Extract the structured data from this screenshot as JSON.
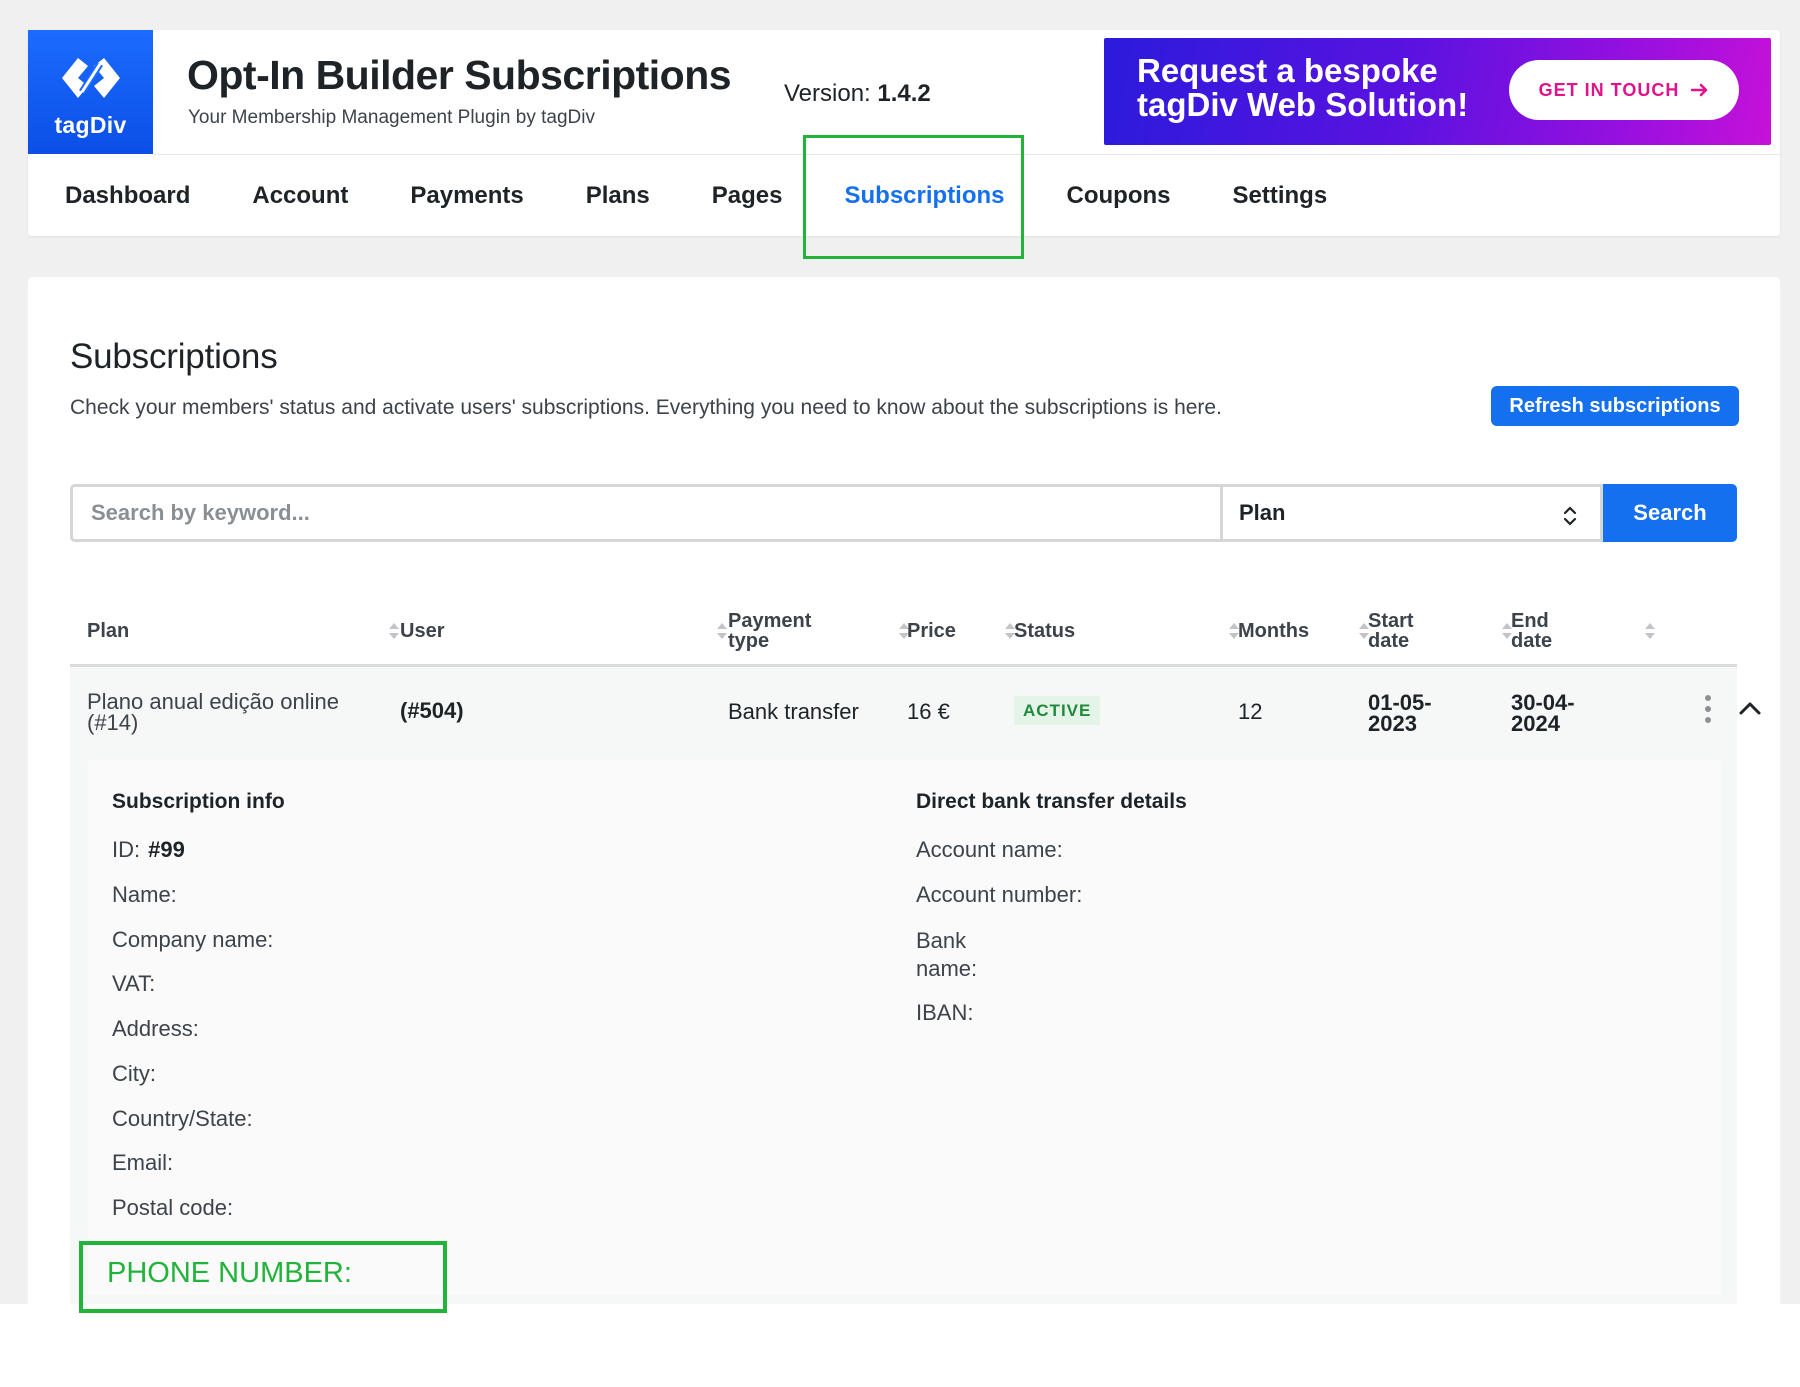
{
  "header": {
    "logo_text": "tagDiv",
    "title": "Opt-In Builder Subscriptions",
    "subtitle": "Your Membership Management Plugin by tagDiv",
    "version_label": "Version:",
    "version_value": "1.4.2",
    "banner_text": "Request a bespoke tagDiv Web Solution!",
    "banner_button": "GET IN TOUCH"
  },
  "nav": {
    "items": [
      {
        "label": "Dashboard"
      },
      {
        "label": "Account"
      },
      {
        "label": "Payments"
      },
      {
        "label": "Plans"
      },
      {
        "label": "Pages"
      },
      {
        "label": "Subscriptions",
        "active": true
      },
      {
        "label": "Coupons"
      },
      {
        "label": "Settings"
      }
    ]
  },
  "main": {
    "title": "Subscriptions",
    "description": "Check your members' status and activate users' subscriptions. Everything you need to know about the subscriptions is here.",
    "refresh_button": "Refresh subscriptions",
    "search_placeholder": "Search by keyword...",
    "plan_select": "Plan",
    "search_button": "Search"
  },
  "table": {
    "columns": {
      "plan": "Plan",
      "user": "User",
      "payment_type": "Payment type",
      "price": "Price",
      "status": "Status",
      "months": "Months",
      "start_date": "Start date",
      "end_date": "End date"
    },
    "rows": [
      {
        "plan": "Plano anual edição online (#14)",
        "user": "(#504)",
        "payment_type": "Bank transfer",
        "price": "16 €",
        "status": "ACTIVE",
        "months": "12",
        "start_date": "01-05-2023",
        "end_date": "30-04-2024"
      }
    ]
  },
  "details": {
    "subscription_info_title": "Subscription info",
    "id_label": "ID:",
    "id_value": "#99",
    "name_label": "Name:",
    "company_label": "Company name:",
    "vat_label": "VAT:",
    "address_label": "Address:",
    "city_label": "City:",
    "country_label": "Country/State:",
    "email_label": "Email:",
    "postal_label": "Postal code:",
    "phone_label": "PHONE NUMBER:",
    "bank_title": "Direct bank transfer details",
    "account_name_label": "Account name:",
    "account_number_label": "Account number:",
    "bank_name_label": "Bank name:",
    "iban_label": "IBAN:"
  },
  "colors": {
    "accent": "#1570ef",
    "highlight": "#22b33a",
    "status_active_bg": "#e5f4e8",
    "status_active_fg": "#1e8a3a"
  }
}
